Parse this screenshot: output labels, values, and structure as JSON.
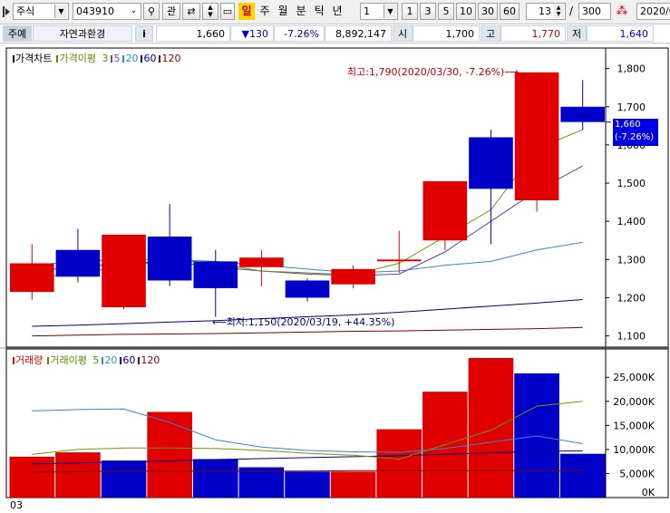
{
  "toolbar": {
    "market_type": "주식",
    "stock_code": "043910",
    "search_icon": "search-icon",
    "related_label": "관",
    "periods": [
      "일",
      "주",
      "월",
      "분",
      "틱",
      "년"
    ],
    "active_period": "일",
    "interval_value": "1",
    "quick_intervals": [
      "1",
      "3",
      "5",
      "10",
      "30",
      "60"
    ],
    "count_value": "13",
    "count_separator": "/",
    "total_count": "300",
    "date_value": "2020/0"
  },
  "quote": {
    "type_label": "주예",
    "stock_name": "자연과환경",
    "info_label": "i",
    "price": "1,660",
    "change": "▼130",
    "change_pct": "-7.26%",
    "volume": "8,892,147",
    "open_label": "시",
    "open": "1,700",
    "high_label": "고",
    "high": "1,770",
    "low_label": "저",
    "low": "1,640"
  },
  "colors": {
    "up": "#e00000",
    "down": "#0000c8",
    "ma5": "#5c8a00",
    "ma20": "#3388cc",
    "ma60": "#000080",
    "ma120": "#800000",
    "price_tag_bg": "#0000e0"
  },
  "chart_data": [
    {
      "type": "candlestick",
      "legend": {
        "title": "가격차트",
        "ma_label": "가격이평",
        "periods": [
          "3",
          "5",
          "20",
          "60",
          "120"
        ]
      },
      "ylim": [
        1080,
        1830
      ],
      "yticks": [
        "1,800",
        "1,700",
        "1,600",
        "1,500",
        "1,400",
        "1,300",
        "1,200",
        "1,100"
      ],
      "ytick_values": [
        1800,
        1700,
        1600,
        1500,
        1400,
        1300,
        1200,
        1100
      ],
      "candles": [
        {
          "open": 1215,
          "high": 1340,
          "low": 1195,
          "close": 1290,
          "dir": "up"
        },
        {
          "open": 1325,
          "high": 1380,
          "low": 1240,
          "close": 1255,
          "dir": "down"
        },
        {
          "open": 1175,
          "high": 1365,
          "low": 1170,
          "close": 1365,
          "dir": "up"
        },
        {
          "open": 1360,
          "high": 1445,
          "low": 1230,
          "close": 1245,
          "dir": "down"
        },
        {
          "open": 1295,
          "high": 1325,
          "low": 1150,
          "close": 1225,
          "dir": "down"
        },
        {
          "open": 1280,
          "high": 1325,
          "low": 1230,
          "close": 1305,
          "dir": "up"
        },
        {
          "open": 1245,
          "high": 1250,
          "low": 1190,
          "close": 1200,
          "dir": "down"
        },
        {
          "open": 1235,
          "high": 1285,
          "low": 1225,
          "close": 1275,
          "dir": "up"
        },
        {
          "open": 1300,
          "high": 1375,
          "low": 1265,
          "close": 1300,
          "dir": "up"
        },
        {
          "open": 1350,
          "high": 1505,
          "low": 1325,
          "close": 1505,
          "dir": "up"
        },
        {
          "open": 1620,
          "high": 1640,
          "low": 1340,
          "close": 1485,
          "dir": "down"
        },
        {
          "open": 1455,
          "high": 1790,
          "low": 1425,
          "close": 1790,
          "dir": "up"
        },
        {
          "open": 1700,
          "high": 1770,
          "low": 1640,
          "close": 1660,
          "dir": "down"
        }
      ],
      "ma5": [
        1250,
        1265,
        1280,
        1300,
        1290,
        1270,
        1265,
        1260,
        1290,
        1360,
        1430,
        1590,
        1640
      ],
      "ma20": [
        1285,
        1295,
        1300,
        1300,
        1295,
        1285,
        1275,
        1265,
        1270,
        1285,
        1295,
        1325,
        1345
      ],
      "ma60": [
        1270,
        1280,
        1290,
        1295,
        1280,
        1270,
        1262,
        1258,
        1262,
        1320,
        1400,
        1480,
        1545
      ],
      "ma120": [
        1125,
        1128,
        1132,
        1136,
        1140,
        1145,
        1150,
        1155,
        1162,
        1170,
        1178,
        1186,
        1195
      ],
      "ma_long": [
        1100,
        1102,
        1104,
        1105,
        1106,
        1108,
        1110,
        1112,
        1113,
        1115,
        1117,
        1119,
        1122
      ],
      "annotations": {
        "high": "최고:1,790(2020/03/30, -7.26%)",
        "low": "최저:1,150(2020/03/19, +44.35%)"
      },
      "current_price_tag": {
        "price": "1,660",
        "pct": "(-7.26%)",
        "value": 1660
      }
    },
    {
      "type": "bar",
      "legend": {
        "title": "거래량",
        "ma_label": "거래이평",
        "periods": [
          "5",
          "20",
          "60",
          "120"
        ]
      },
      "ylim": [
        0,
        29000
      ],
      "yticks": [
        "25,000K",
        "20,000K",
        "15,000K",
        "10,000K",
        "5,000K",
        "0K"
      ],
      "ytick_values": [
        25000,
        20000,
        15000,
        10000,
        5000,
        0
      ],
      "values": [
        8500,
        9400,
        7700,
        17800,
        8000,
        6300,
        5400,
        5400,
        14200,
        22000,
        29000,
        25800,
        9100
      ],
      "dirs": [
        "up",
        "up",
        "down",
        "up",
        "down",
        "down",
        "down",
        "up",
        "up",
        "up",
        "up",
        "down",
        "down"
      ],
      "ma5": [
        9000,
        10000,
        10300,
        10300,
        10200,
        9800,
        9200,
        8800,
        8000,
        11000,
        14000,
        19000,
        20000
      ],
      "ma20": [
        18000,
        18300,
        18400,
        15600,
        12000,
        10500,
        9800,
        9500,
        9400,
        10200,
        11500,
        12800,
        11200
      ],
      "ma60": [
        7000,
        7200,
        7400,
        7600,
        7900,
        8100,
        8300,
        8500,
        8700,
        9000,
        9300,
        9600,
        9700
      ],
      "ma120": [
        5300,
        5400,
        5500,
        5500,
        5500,
        5500,
        5500,
        5600,
        5600,
        5600,
        5600,
        5600,
        5600
      ],
      "x_start_label": "03"
    }
  ]
}
